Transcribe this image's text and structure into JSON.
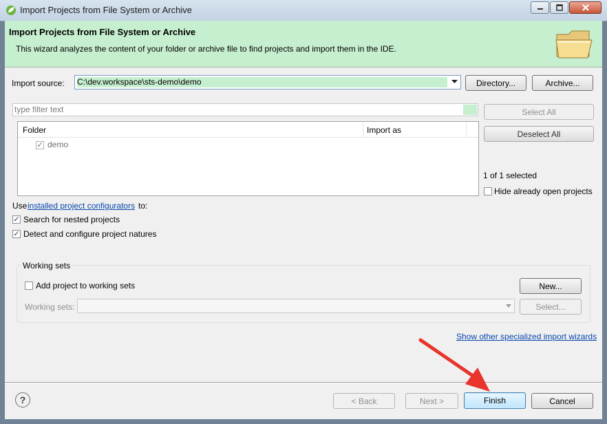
{
  "window": {
    "title": "Import Projects from File System or Archive"
  },
  "banner": {
    "title": "Import Projects from File System or Archive",
    "description": "This wizard analyzes the content of your folder or archive file to find projects and import them in the IDE."
  },
  "import_source": {
    "label": "Import source:",
    "value": "C:\\dev.workspace\\sts-demo\\demo",
    "directory_button": "Directory...",
    "archive_button": "Archive..."
  },
  "filter": {
    "placeholder": "type filter text"
  },
  "table": {
    "columns": [
      "Folder",
      "Import as"
    ],
    "rows": [
      {
        "folder": "demo",
        "import_as": "",
        "checked": true
      }
    ]
  },
  "selection": {
    "select_all": "Select All",
    "deselect_all": "Deselect All",
    "count": "1 of 1 selected",
    "hide_open_label": "Hide already open projects"
  },
  "configurators": {
    "prefix": "Use",
    "link": "installed project configurators",
    "suffix": "to:",
    "nested_label": "Search for nested projects",
    "natures_label": "Detect and configure project natures"
  },
  "working_sets": {
    "group_title": "Working sets",
    "add_label": "Add project to working sets",
    "new_button": "New...",
    "sets_label": "Working sets:",
    "select_button": "Select..."
  },
  "footer": {
    "specialized_link": "Show other specialized import wizards",
    "help_icon": "?",
    "back": "< Back",
    "next": "Next >",
    "finish": "Finish",
    "cancel": "Cancel"
  },
  "colors": {
    "banner": "#c6efcf",
    "input_highlight": "#c6efcf",
    "link": "#0645ad",
    "arrow": "#e8342d"
  },
  "icons": [
    "spring-leaf-icon",
    "minimize-icon",
    "maximize-icon",
    "close-icon",
    "folder-icon",
    "chevron-down-icon",
    "check-icon",
    "help-icon",
    "red-arrow-annotation"
  ]
}
